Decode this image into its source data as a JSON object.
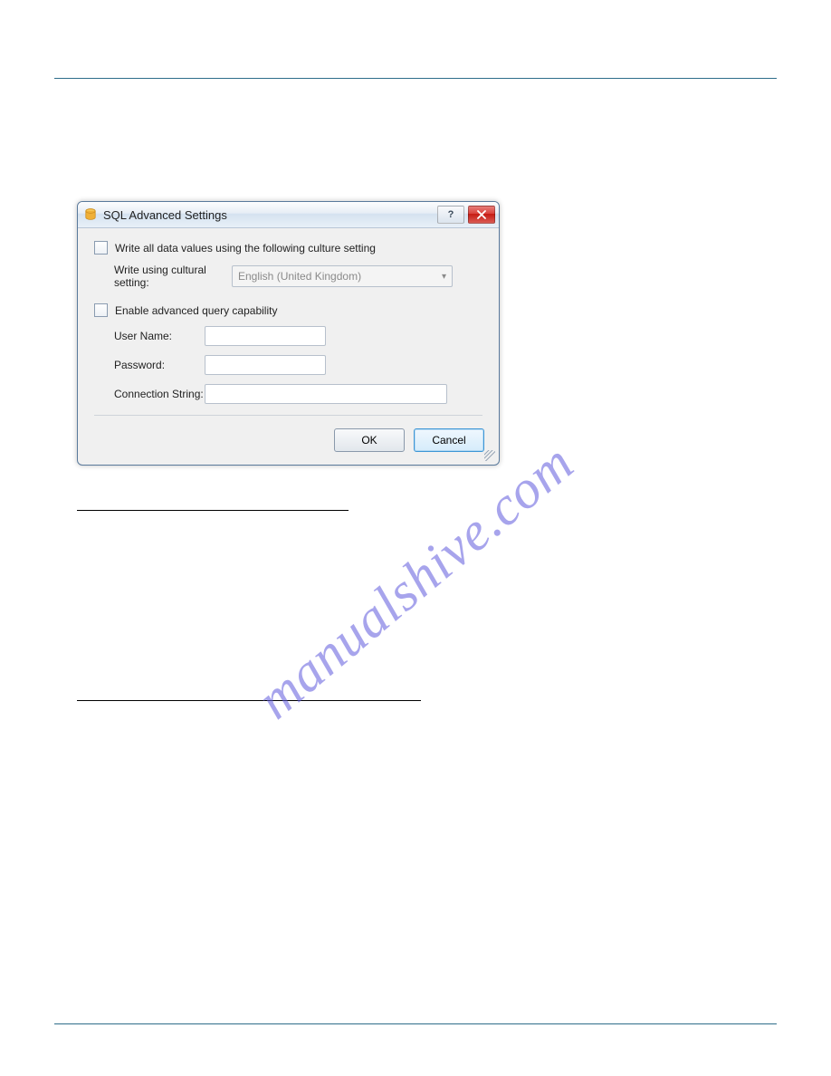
{
  "dialog": {
    "title": "SQL Advanced Settings",
    "check_culture": "Write all data values using the following culture setting",
    "culture_label": "Write using cultural setting:",
    "culture_value": "English (United Kingdom)",
    "check_query": "Enable advanced query capability",
    "user_label": "User Name:",
    "pass_label": "Password:",
    "conn_label": "Connection String:",
    "ok": "OK",
    "cancel": "Cancel"
  },
  "sections": {
    "h1": "",
    "h2": ""
  },
  "watermark": "manualshive.com"
}
